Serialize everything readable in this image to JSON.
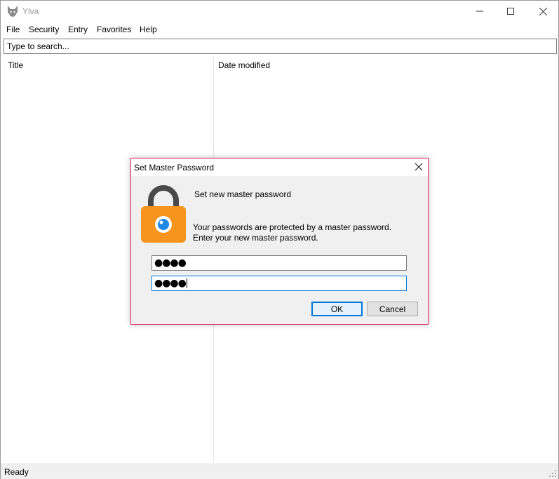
{
  "window": {
    "title": "Ylva"
  },
  "menu": {
    "items": [
      "File",
      "Security",
      "Entry",
      "Favorites",
      "Help"
    ]
  },
  "search": {
    "placeholder": "Type to search...",
    "value": ""
  },
  "list": {
    "columns": [
      "Title",
      "Date modified"
    ],
    "rows": []
  },
  "status": {
    "text": "Ready"
  },
  "dialog": {
    "title": "Set Master Password",
    "heading": "Set new master password",
    "message_line1": "Your passwords are protected by a master password.",
    "message_line2": "Enter your new master password.",
    "password1": "●●●●",
    "password2": "●●●●",
    "ok_label": "OK",
    "cancel_label": "Cancel"
  },
  "icons": {
    "app": "wolf-head-icon",
    "lock": "padlock-eye-icon"
  },
  "colors": {
    "lock_body": "#f7941d",
    "lock_shackle": "#4a4a4a",
    "eye": "#1e88e5",
    "dialog_border": "#e0245e",
    "focus": "#0078d7"
  }
}
